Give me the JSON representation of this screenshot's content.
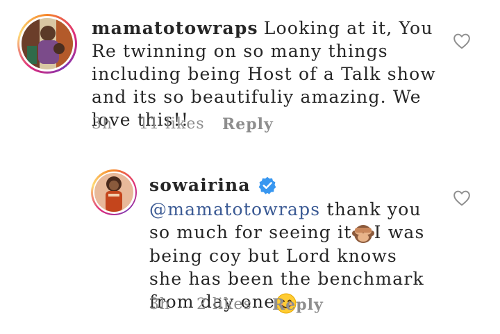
{
  "comments": [
    {
      "username": "mamatotowraps",
      "text": "Looking at it, You Re twinning on so many things including being Host of a Talk show and its so beautifuliy amazing. We love this!!",
      "time": "3h",
      "likes": "11 likes",
      "reply_label": "Reply",
      "icons": [
        "like-heart-icon"
      ]
    },
    {
      "username": "sowairina",
      "verified": true,
      "mention": "@mamatotowraps",
      "text_part1": "thank you so much for seeing it",
      "text_part2": "I was being coy but Lord knows she has been the benchmark from day one",
      "emoji1": "see-no-evil-monkey",
      "emoji2": "smiling-face",
      "time": "3h",
      "likes": "2 likes",
      "reply_label": "Reply",
      "icons": [
        "verified-badge-icon",
        "like-heart-icon"
      ]
    }
  ],
  "colors": {
    "text": "#262626",
    "meta": "#8e8e8e",
    "mention": "#3b5a94",
    "verified": "#3897f0"
  }
}
